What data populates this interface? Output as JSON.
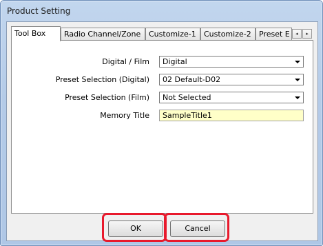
{
  "window": {
    "title": "Product Setting"
  },
  "tabs": [
    {
      "label": "Tool Box",
      "active": true
    },
    {
      "label": "Radio Channel/Zone",
      "active": false
    },
    {
      "label": "Customize-1",
      "active": false
    },
    {
      "label": "Customize-2",
      "active": false
    },
    {
      "label": "Preset E",
      "active": false
    }
  ],
  "tab_scroll": {
    "left_icon": "◂",
    "right_icon": "▸"
  },
  "form": {
    "digital_film": {
      "label": "Digital / Film",
      "value": "Digital"
    },
    "preset_digital": {
      "label": "Preset Selection (Digital)",
      "value": "02 Default-D02"
    },
    "preset_film": {
      "label": "Preset Selection (Film)",
      "value": "Not Selected"
    },
    "memory_title": {
      "label": "Memory Title",
      "value": "SampleTitle1"
    }
  },
  "buttons": {
    "ok": "OK",
    "cancel": "Cancel"
  },
  "colors": {
    "highlight": "#e8192c",
    "memory_title_bg": "#ffffc8"
  }
}
